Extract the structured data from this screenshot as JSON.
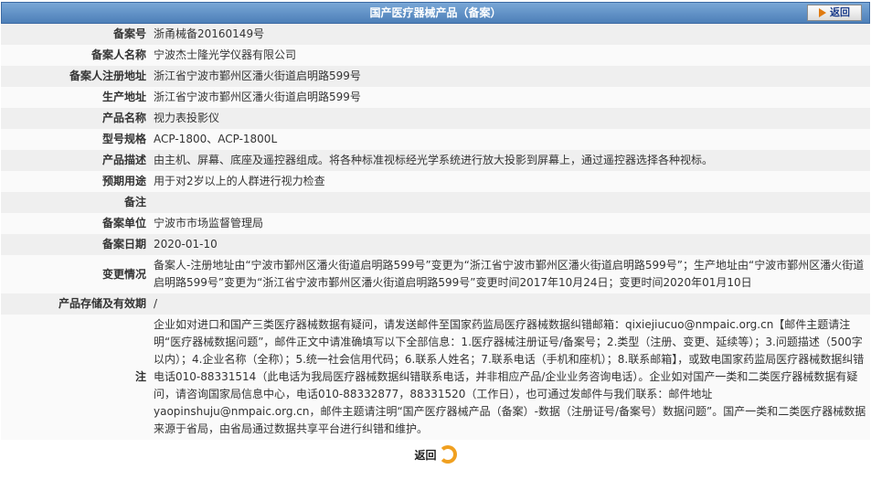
{
  "header": {
    "title": "国产医疗器械产品（备案）",
    "back_label": "返回"
  },
  "rows": [
    {
      "label": "备案号",
      "value": "浙甬械备20160149号"
    },
    {
      "label": "备案人名称",
      "value": "宁波杰士隆光学仪器有限公司"
    },
    {
      "label": "备案人注册地址",
      "value": "浙江省宁波市鄞州区潘火街道启明路599号"
    },
    {
      "label": "生产地址",
      "value": "浙江省宁波市鄞州区潘火街道启明路599号"
    },
    {
      "label": "产品名称",
      "value": "视力表投影仪"
    },
    {
      "label": "型号规格",
      "value": "ACP-1800、ACP-1800L"
    },
    {
      "label": "产品描述",
      "value": "由主机、屏幕、底座及遥控器组成。将各种标准视标经光学系统进行放大投影到屏幕上，通过遥控器选择各种视标。"
    },
    {
      "label": "预期用途",
      "value": "用于对2岁以上的人群进行视力检查"
    },
    {
      "label": "备注",
      "value": ""
    },
    {
      "label": "备案单位",
      "value": "宁波市市场监督管理局"
    },
    {
      "label": "备案日期",
      "value": "2020-01-10"
    },
    {
      "label": "变更情况",
      "value": "备案人-注册地址由“宁波市鄞州区潘火街道启明路599号”变更为“浙江省宁波市鄞州区潘火街道启明路599号”；生产地址由“宁波市鄞州区潘火街道启明路599号”变更为“浙江省宁波市鄞州区潘火街道启明路599号”变更时间2017年10月24日；变更时间2020年01月10日"
    },
    {
      "label": "产品存储及有效期",
      "value": "/"
    },
    {
      "label": "注",
      "value": "企业如对进口和国产三类医疗器械数据有疑问，请发送邮件至国家药监局医疗器械数据纠错邮箱：qixiejiucuo@nmpaic.org.cn【邮件主题请注明“医疗器械数据问题”，邮件正文中请准确填写以下全部信息：1.医疗器械注册证号/备案号；2.类型（注册、变更、延续等）；3.问题描述（500字以内）；4.企业名称（全称）；5.统一社会信用代码；6.联系人姓名；7.联系电话（手机和座机）；8.联系邮箱】，或致电国家药监局医疗器械数据纠错电话010-88331514（此电话为我局医疗器械数据纠错联系电话，并非相应产品/企业业务咨询电话）。企业如对国产一类和二类医疗器械数据有疑问，请咨询国家局信息中心，电话010-88332877，88331520（工作日），也可通过发邮件与我们联系：邮件地址yaopinshuju@nmpaic.org.cn，邮件主题请注明“国产医疗器械产品（备案）-数据（注册证号/备案号）数据问题”。国产一类和二类医疗器械数据来源于省局，由省局通过数据共享平台进行纠错和维护。"
    }
  ],
  "footer": {
    "back_label": "返回"
  }
}
